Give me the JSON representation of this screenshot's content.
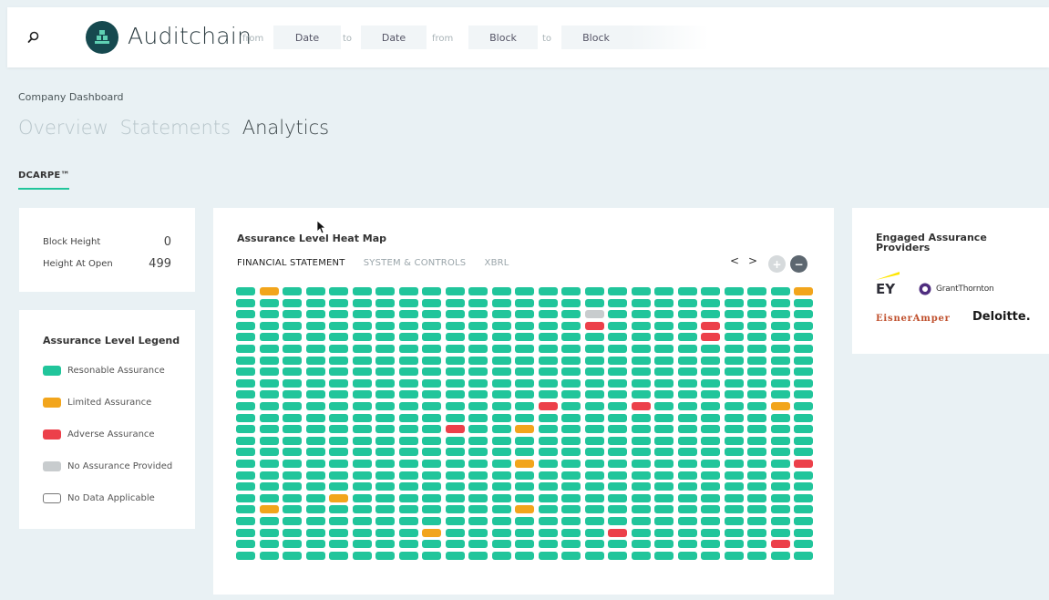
{
  "header": {
    "brand": "Auditchain",
    "filters": [
      {
        "label": "from",
        "value": "Date"
      },
      {
        "label": "to",
        "value": "Date"
      },
      {
        "label": "from",
        "value": "Block"
      },
      {
        "label": "to",
        "value": "Block"
      }
    ],
    "icons": {
      "search": "search-icon",
      "logo": "auditchain-logo-icon"
    }
  },
  "breadcrumb": "Company Dashboard",
  "tabs": [
    {
      "label": "Overview",
      "active": false
    },
    {
      "label": "Statements",
      "active": false
    },
    {
      "label": "Analytics",
      "active": true
    }
  ],
  "subtab": "DCARPE™",
  "stats": [
    {
      "label": "Block Height",
      "value": "0"
    },
    {
      "label": "Height At Open",
      "value": "499"
    }
  ],
  "legend": {
    "title": "Assurance Level Legend",
    "items": [
      {
        "label": "Resonable Assurance",
        "color": "#21c59b"
      },
      {
        "label": "Limited Assurance",
        "color": "#f2a51c"
      },
      {
        "label": "Adverse Assurance",
        "color": "#ec404a"
      },
      {
        "label": "No Assurance Provided",
        "color": "#c8ccce"
      },
      {
        "label": "No Data Applicable",
        "color": "#ffffff"
      }
    ]
  },
  "heatmap": {
    "title": "Assurance Level Heat Map",
    "tabs": [
      {
        "label": "FINANCIAL STATEMENT",
        "active": true
      },
      {
        "label": "SYSTEM & CONTROLS",
        "active": false
      },
      {
        "label": "XBRL",
        "active": false
      }
    ],
    "nav": {
      "prev": "<",
      "next": ">",
      "zoom_in": "+",
      "zoom_out": "−"
    },
    "rows": 24,
    "cols": 25,
    "colors": {
      "reasonable": "#21c59b",
      "limited": "#f2a51c",
      "adverse": "#ec404a",
      "none": "#c8ccce"
    },
    "exceptions": [
      {
        "row": 0,
        "col": 1,
        "level": "limited"
      },
      {
        "row": 0,
        "col": 24,
        "level": "limited"
      },
      {
        "row": 2,
        "col": 15,
        "level": "none"
      },
      {
        "row": 3,
        "col": 15,
        "level": "adverse"
      },
      {
        "row": 3,
        "col": 20,
        "level": "adverse"
      },
      {
        "row": 4,
        "col": 20,
        "level": "adverse"
      },
      {
        "row": 10,
        "col": 13,
        "level": "adverse"
      },
      {
        "row": 10,
        "col": 17,
        "level": "adverse"
      },
      {
        "row": 10,
        "col": 23,
        "level": "limited"
      },
      {
        "row": 12,
        "col": 9,
        "level": "adverse"
      },
      {
        "row": 12,
        "col": 12,
        "level": "limited"
      },
      {
        "row": 15,
        "col": 12,
        "level": "limited"
      },
      {
        "row": 15,
        "col": 24,
        "level": "adverse"
      },
      {
        "row": 18,
        "col": 4,
        "level": "limited"
      },
      {
        "row": 19,
        "col": 1,
        "level": "limited"
      },
      {
        "row": 19,
        "col": 12,
        "level": "limited"
      },
      {
        "row": 21,
        "col": 8,
        "level": "limited"
      },
      {
        "row": 21,
        "col": 16,
        "level": "adverse"
      },
      {
        "row": 22,
        "col": 23,
        "level": "adverse"
      }
    ]
  },
  "providers": {
    "title": "Engaged Assurance Providers",
    "logos": [
      {
        "name": "EY",
        "color": "#2e2e38"
      },
      {
        "name": "GrantThornton",
        "color": "#4f2d7f"
      },
      {
        "name": "EisnerAmper",
        "color": "#c0512e"
      },
      {
        "name": "Deloitte.",
        "color": "#1a1a1a"
      }
    ]
  }
}
